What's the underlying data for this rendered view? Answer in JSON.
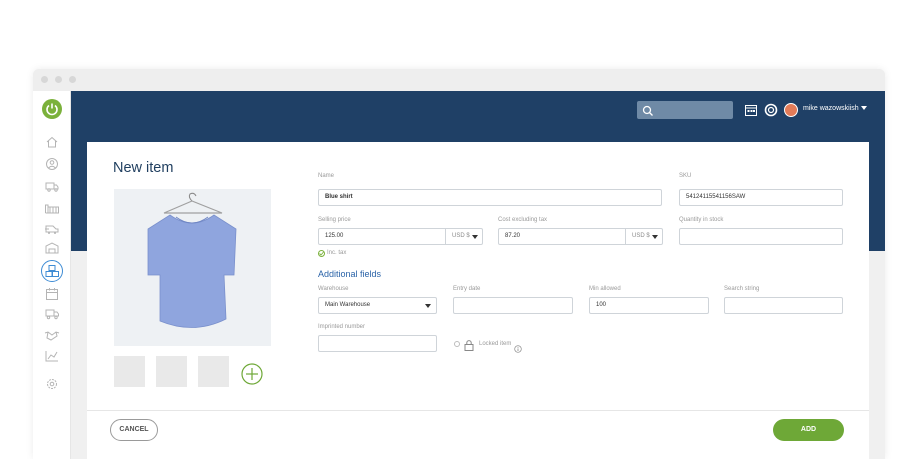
{
  "app": {
    "user": "mike wazowskiish",
    "search_placeholder": ""
  },
  "colors": {
    "topbar": "#1f4066",
    "accent": "#7bb13b",
    "link": "#2a63a8",
    "primary_button": "#6ea837"
  },
  "sidebar": {
    "items": [
      {
        "icon": "power-icon"
      },
      {
        "icon": "home-icon"
      },
      {
        "icon": "user-icon"
      },
      {
        "icon": "truck-icon"
      },
      {
        "icon": "factory-icon"
      },
      {
        "icon": "delivery-icon"
      },
      {
        "icon": "warehouse-icon"
      },
      {
        "icon": "boxes-icon",
        "active": true
      },
      {
        "icon": "calendar-icon"
      },
      {
        "icon": "shipping-icon"
      },
      {
        "icon": "handshake-icon"
      },
      {
        "icon": "chart-icon"
      },
      {
        "icon": "settings-icon"
      }
    ]
  },
  "form": {
    "title": "New item",
    "name_label": "Name",
    "name_value": "Blue shirt",
    "sku_label": "SKU",
    "sku_value": "54124115541156SAW",
    "selling_price_label": "Selling price",
    "selling_price_value": "125.00",
    "selling_price_currency": "USD $",
    "cost_label": "Cost excluding tax",
    "cost_value": "87.20",
    "cost_currency": "USD $",
    "quantity_label": "Quantity in stock",
    "quantity_value": "",
    "inc_tax_label": "Inc. tax",
    "additional_title": "Additional fields",
    "warehouse_label": "Warehouse",
    "warehouse_value": "Main Warehouse",
    "entry_date_label": "Entry date",
    "entry_date_value": "",
    "min_allowed_label": "Min allowed",
    "min_allowed_value": "100",
    "search_string_label": "Search string",
    "search_string_value": "",
    "imprinted_label": "Imprinted number",
    "imprinted_value": "",
    "locked_label": "Locked item"
  },
  "footer": {
    "cancel_label": "CANCEL",
    "add_label": "ADD"
  }
}
